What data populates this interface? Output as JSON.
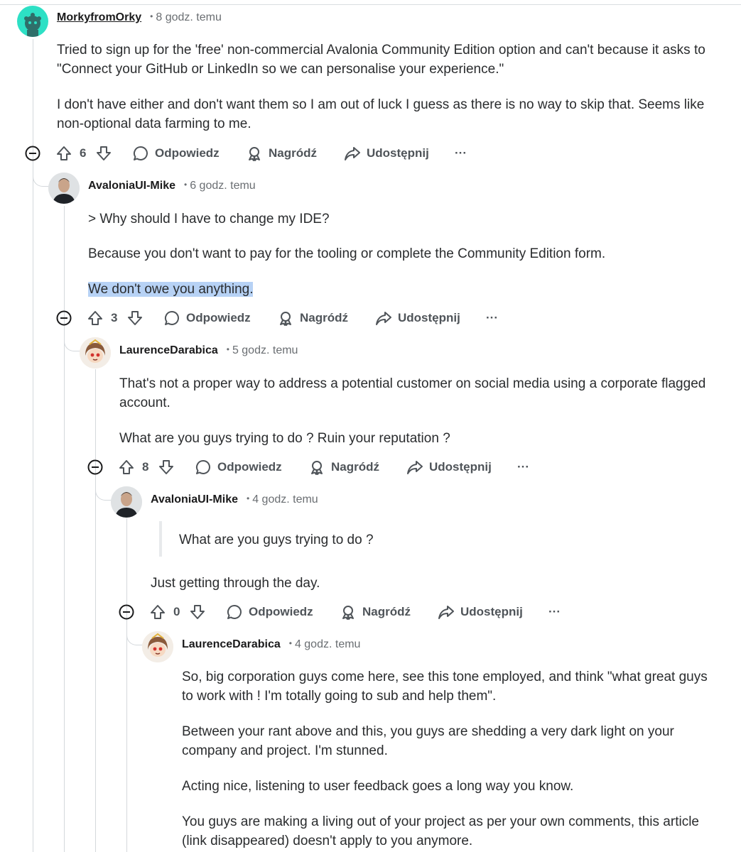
{
  "comments": [
    {
      "username": "MorkyfromOrky",
      "time": "8 godz. temu",
      "paragraphs": [
        "Tried to sign up for the 'free' non-commercial Avalonia Community Edition option and can't because it asks to \"Connect your GitHub or LinkedIn so we can personalise your experience.\"",
        "I don't have either and don't want them so I am out of luck I guess as there is no way to skip that. Seems like non-optional data farming to me."
      ],
      "votes": "6"
    },
    {
      "username": "AvaloniaUI-Mike",
      "time": "6 godz. temu",
      "paragraphs": [
        "> Why should I have to change my IDE?",
        "Because you don't want to pay for the tooling or complete the Community Edition form.",
        "We don't owe you anything."
      ],
      "votes": "3"
    },
    {
      "username": "LaurenceDarabica",
      "time": "5 godz. temu",
      "paragraphs": [
        "That's not a proper way to address a potential customer on social media using a corporate flagged account.",
        "What are you guys trying to do ? Ruin your reputation ?"
      ],
      "votes": "8"
    },
    {
      "username": "AvaloniaUI-Mike",
      "time": "4 godz. temu",
      "quote": "What are you guys trying to do ?",
      "paragraphs": [
        "Just getting through the day."
      ],
      "votes": "0"
    },
    {
      "username": "LaurenceDarabica",
      "time": "4 godz. temu",
      "paragraphs": [
        "So, big corporation guys come here, see this tone employed, and think \"what great guys to work with ! I'm totally going to sub and help them\".",
        "Between your rant above and this, you guys are shedding a very dark light on your company and project. I'm stunned.",
        "Acting nice, listening to user feedback goes a long way you know.",
        "You guys are making a living out of your project as per your own comments, this article (link disappeared) doesn't apply to you anymore."
      ]
    }
  ],
  "actions": {
    "reply": "Odpowiedz",
    "award": "Nagródź",
    "share": "Udostępnij",
    "more": "···"
  },
  "colors": {
    "highlight": "#b7d2f5",
    "snoo_avatar": "#2de0c5",
    "thread_line": "#d4d8dc",
    "meta_text": "#6a6e72"
  }
}
